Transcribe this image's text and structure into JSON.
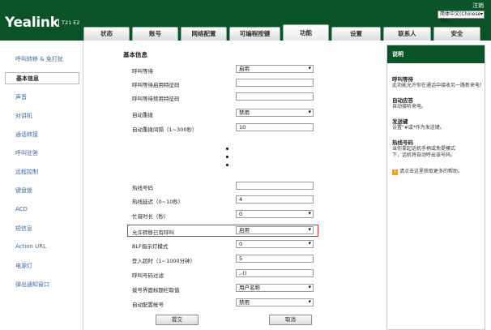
{
  "header": {
    "logo": "Yealink",
    "model": "T21 E2",
    "logout": "注销",
    "language": "简体中文(Chinese Sim"
  },
  "tabs": [
    "状态",
    "账号",
    "网络配置",
    "可编程按键",
    "功能",
    "设置",
    "联系人",
    "安全"
  ],
  "sidebar": {
    "items": [
      "呼叫转移 & 免打扰",
      "基本信息",
      "声音",
      "对讲机",
      "通话转接",
      "呼叫驻答",
      "远程控制",
      "键盘锁",
      "ACD",
      "短信息",
      "Action URL",
      "电源灯",
      "弹出通知窗口"
    ]
  },
  "main": {
    "section_title": "基本信息",
    "rows_top": [
      {
        "label": "呼叫等待",
        "type": "select",
        "value": "启用"
      },
      {
        "label": "呼叫等待启用特征码",
        "type": "input",
        "value": ""
      },
      {
        "label": "呼叫等待禁用特征码",
        "type": "input",
        "value": ""
      },
      {
        "label": "自动重拨",
        "type": "select",
        "value": "禁用"
      },
      {
        "label": "自动重拨间隔（1~300秒）",
        "type": "input",
        "value": "10"
      }
    ],
    "rows_bottom": [
      {
        "label": "热线号码",
        "type": "input",
        "value": ""
      },
      {
        "label": "热线延迟（0~10秒）",
        "type": "input",
        "value": "4"
      },
      {
        "label": "忙音时长（秒）",
        "type": "select",
        "value": "0"
      },
      {
        "label": "允许转移已有呼叫",
        "type": "select",
        "value": "启用"
      },
      {
        "label": "BLF指示灯模式",
        "type": "select",
        "value": "0"
      },
      {
        "label": "登入超时（1~1000分钟）",
        "type": "input",
        "value": "5"
      },
      {
        "label": "呼叫号码过滤",
        "type": "input",
        "value": ",-()"
      },
      {
        "label": "拨号界面标题栏取值",
        "type": "select",
        "value": "用户名称"
      },
      {
        "label": "自动配置帐号",
        "type": "select",
        "value": "禁用"
      }
    ],
    "submit_label": "提交",
    "cancel_label": "取消"
  },
  "help": {
    "title": "说明",
    "topics": [
      {
        "title": "呼叫等待",
        "desc": [
          "此功能允许你在通话中接收另一路新来电！"
        ]
      },
      {
        "title": "自动应答",
        "desc": [
          "自动接听来电。"
        ]
      },
      {
        "title": "发送键",
        "desc": [
          "设置\"#或*作为发送键。"
        ]
      },
      {
        "title": "热线号码",
        "desc": [
          "当你拿起话机手柄或免提模式",
          "下，话机将自动呼出该号码。"
        ]
      }
    ],
    "more": "请点击这里获取更多的帮助。"
  },
  "colors": {
    "header_bg": "#0a5227",
    "highlight": "#d9342b",
    "link": "#3a6aa6"
  }
}
